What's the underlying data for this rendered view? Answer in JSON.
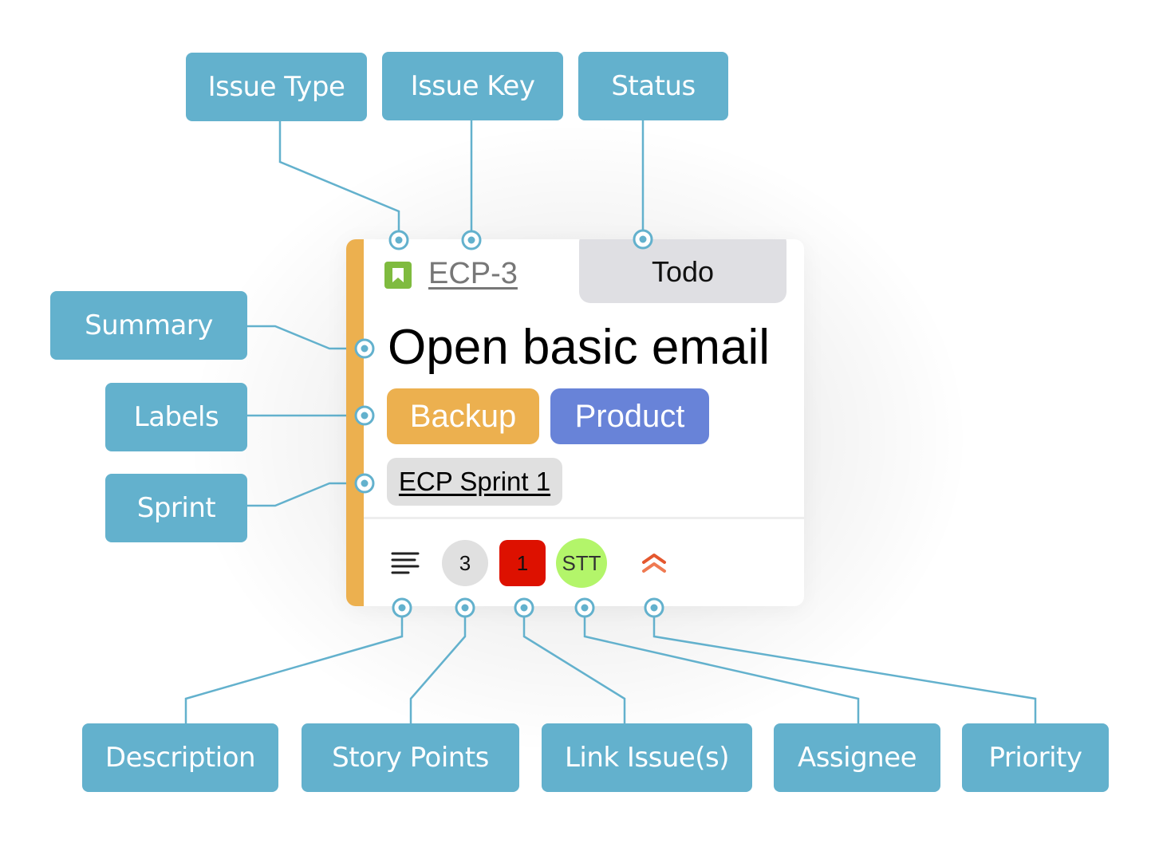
{
  "callouts": {
    "issue_type": "Issue Type",
    "issue_key": "Issue Key",
    "status": "Status",
    "summary": "Summary",
    "labels": "Labels",
    "sprint": "Sprint",
    "description": "Description",
    "story_points": "Story Points",
    "link_issues": "Link Issue(s)",
    "assignee": "Assignee",
    "priority": "Priority"
  },
  "card": {
    "issue_type_icon": "bookmark-icon",
    "issue_key": "ECP-3",
    "status": "Todo",
    "summary": "Open basic email",
    "labels": [
      {
        "text": "Backup",
        "color": "#ecb04f"
      },
      {
        "text": "Product",
        "color": "#6883d8"
      }
    ],
    "sprint": "ECP Sprint 1",
    "description_icon": "description-lines-icon",
    "story_points": "3",
    "linked_issues": "1",
    "assignee_initials": "STT",
    "priority_icon": "double-chevron-up-icon",
    "accent_color": "#ecb04f",
    "callout_color": "#63b1cd"
  }
}
